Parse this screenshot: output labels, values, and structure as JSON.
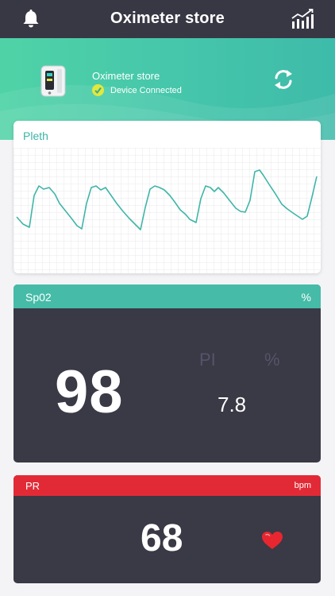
{
  "header": {
    "title": "Oximeter store",
    "left_icon": "bell-icon",
    "right_icon": "stats-chart-icon"
  },
  "device": {
    "name": "Oximeter store",
    "status": "Device Connected",
    "status_icon": "check-circle-icon",
    "action_icon": "refresh-icon"
  },
  "pleth": {
    "label": "Pleth"
  },
  "spo2": {
    "label": "Sp02",
    "unit": "%",
    "value": "98",
    "pi_label": "PI",
    "pi_unit": "%",
    "pi_value": "7.8"
  },
  "pr": {
    "label": "PR",
    "unit": "bpm",
    "value": "68",
    "icon": "heart-icon"
  },
  "colors": {
    "topbar": "#383845",
    "accent_teal": "#45bba8",
    "pr_red": "#e22a36",
    "card_dark": "#3a3946"
  }
}
